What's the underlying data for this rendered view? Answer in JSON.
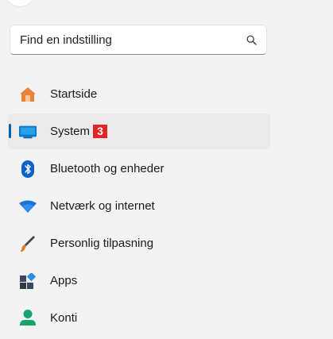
{
  "search": {
    "placeholder": "Find en indstilling",
    "icon": "search-icon"
  },
  "nav": {
    "accent_color": "#005fb8",
    "items": [
      {
        "label": "Startside",
        "icon": "home-icon",
        "selected": false
      },
      {
        "label": "System",
        "icon": "system-monitor-icon",
        "selected": true,
        "badge": "3"
      },
      {
        "label": "Bluetooth og enheder",
        "icon": "bluetooth-icon",
        "selected": false
      },
      {
        "label": "Netværk og internet",
        "icon": "wifi-icon",
        "selected": false
      },
      {
        "label": "Personlig tilpasning",
        "icon": "brush-icon",
        "selected": false
      },
      {
        "label": "Apps",
        "icon": "apps-icon",
        "selected": false
      },
      {
        "label": "Konti",
        "icon": "account-icon",
        "selected": false
      }
    ]
  }
}
